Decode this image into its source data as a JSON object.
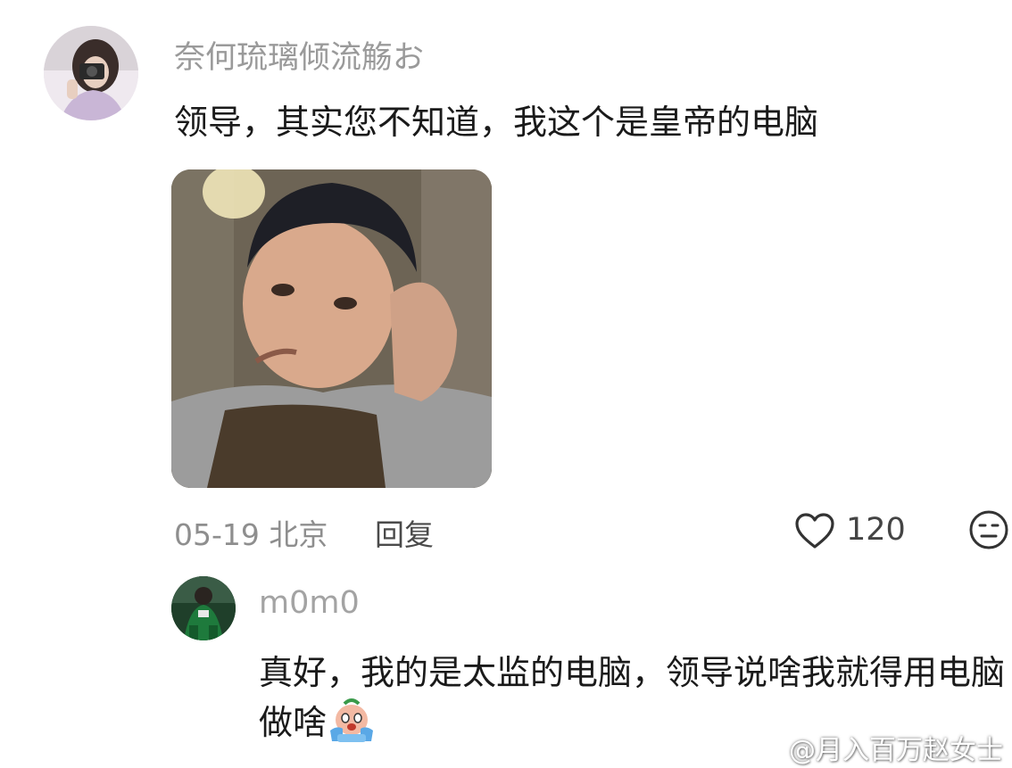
{
  "main_comment": {
    "username": "奈何琉璃倾流觞お",
    "text": "领导，其实您不知道，我这个是皇帝的电脑",
    "date_location": "05-19 北京",
    "reply_label": "回复",
    "like_count": "120",
    "icons": {
      "like": "heart-outline-icon",
      "emoji": "neutral-face-icon"
    }
  },
  "reply_comment": {
    "username": "m0m0",
    "text": "真好，我的是太监的电脑，领导说啥我就得用电脑做啥",
    "emoji": "crying-face-icon"
  },
  "watermark": {
    "text": "@月入百万赵女士",
    "icon": "weibo-logo-icon"
  },
  "colors": {
    "text_primary": "#1a1a1a",
    "text_secondary": "#9a9a9a",
    "background": "#ffffff"
  }
}
